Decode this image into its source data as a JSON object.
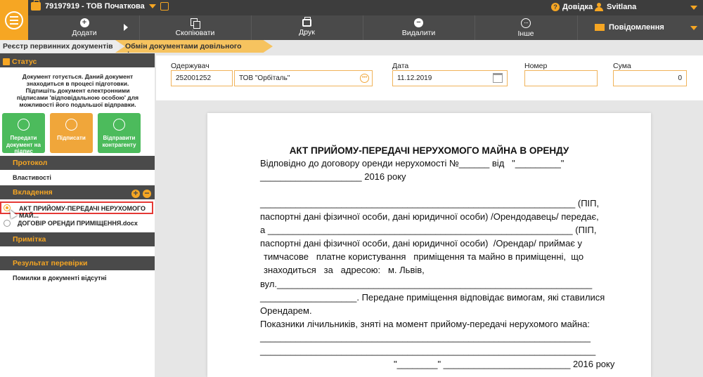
{
  "topbar": {
    "company": "79197919 - ТОВ Початкова",
    "help": "Довідка",
    "user": "Svitlana"
  },
  "toolbar": {
    "add": "Додати",
    "copy": "Скопіювати",
    "print": "Друк",
    "delete": "Видалити",
    "more": "Інше",
    "messages": "Повідомлення"
  },
  "breadcrumb": {
    "first": "Реєстр первинних документів",
    "second": "Обмін документами довільного формату"
  },
  "sidebar": {
    "status_title": "Статус",
    "status_text": "Документ готується. Даний документ знаходиться в процесі підготовки. Підпишіть документ електронними підписами 'відповідальною особою' для можливості його подальшої відправки.",
    "btn_send_sign": "Передати документ на підпис",
    "btn_sign": "Підписати",
    "btn_send_contractor": "Відправити контрагенту",
    "protocol_title": "Протокол",
    "properties": "Властивості",
    "attachments_title": "Вкладення",
    "attachments": [
      {
        "name": "АКТ ПРИЙОМУ-ПЕРЕДАЧІ НЕРУХОМОГО МАЙ..."
      },
      {
        "name": "ДОГОВІР ОРЕНДИ ПРИМІЩЕННЯ.docx"
      }
    ],
    "note_title": "Примітка",
    "check_title": "Результат перевірки",
    "check_text": "Помилки в документі відсутні"
  },
  "form": {
    "recipient_label": "Одержувач",
    "recipient_code": "252001252",
    "recipient_name": "ТОВ \"Орбіталь\"",
    "date_label": "Дата",
    "date_value": "11.12.2019",
    "number_label": "Номер",
    "number_value": "",
    "sum_label": "Сума",
    "sum_value": "0"
  },
  "document": {
    "title": "АКТ ПРИЙОМУ-ПЕРЕДАЧІ НЕРУХОМОГО МАЙНА В ОРЕНДУ",
    "lines": [
      "Відповідно до договору оренди нерухомості №______ від   \"_________\"",
      "____________________ 2016 року",
      "______________________________________________________________ (ПІП,",
      "паспортні дані фізичної особи, дані юридичної особи) /Орендодавець/ передає,",
      "а ____________________________________________________________ (ПІП,",
      "паспортні дані фізичної особи, дані юридичної особи)  /Орендар/ приймає у",
      "тимчасове   платне користування   приміщення та майно в приміщенні,  що",
      "знаходиться   за   адресою:   м. Львів,",
      "вул.______________________________________________________________",
      "___________________. Передане приміщення відповідає вимогам, які ставилися",
      "Орендарем.",
      "Показники лічильників, зняті на момент прийому-передачі нерухомого майна:",
      "_________________________________________________________________",
      "__________________________________________________________________",
      "\"________\" _________________________ 2016 року"
    ]
  }
}
